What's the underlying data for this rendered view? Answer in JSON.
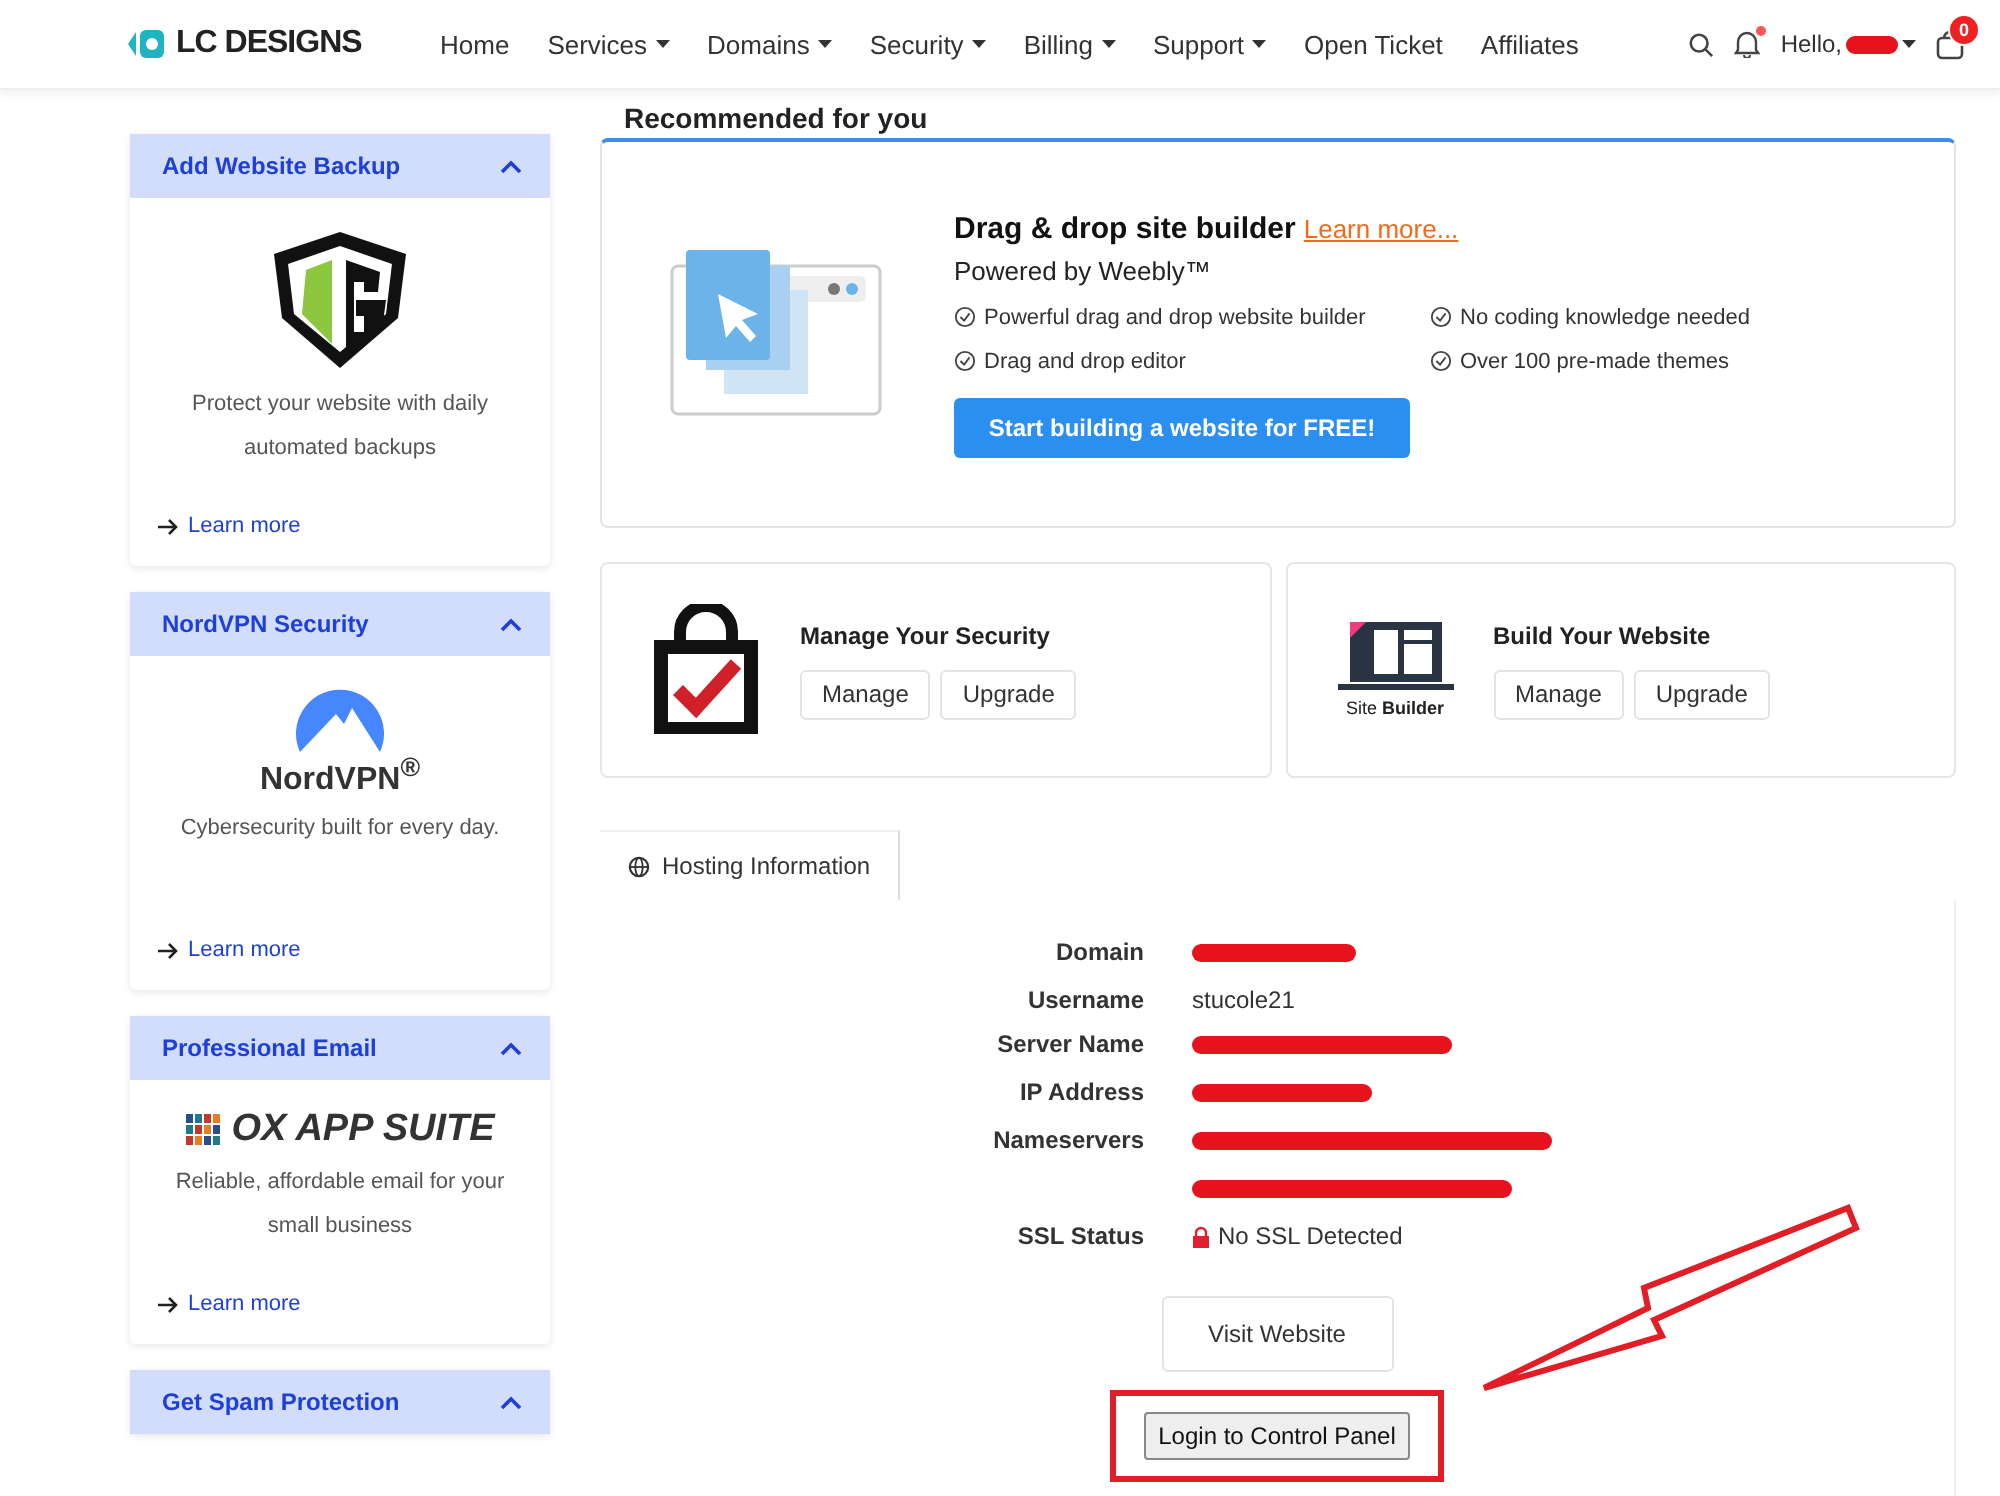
{
  "header": {
    "logo": "LC DESIGNS",
    "nav": [
      {
        "label": "Home",
        "dropdown": false
      },
      {
        "label": "Services",
        "dropdown": true
      },
      {
        "label": "Domains",
        "dropdown": true
      },
      {
        "label": "Security",
        "dropdown": true
      },
      {
        "label": "Billing",
        "dropdown": true
      },
      {
        "label": "Support",
        "dropdown": true
      },
      {
        "label": "Open Ticket",
        "dropdown": false
      },
      {
        "label": "Affiliates",
        "dropdown": false
      }
    ],
    "greeting": "Hello,",
    "notification_dot": true,
    "cart_count": "0"
  },
  "sidebar": {
    "cards": [
      {
        "title": "Add Website Backup",
        "expanded": true,
        "logo": {
          "kind": "shield"
        },
        "description": "Protect your website with daily automated backups",
        "link": "Learn more"
      },
      {
        "title": "NordVPN Security",
        "expanded": true,
        "logo": {
          "kind": "nordvpn",
          "text": "NordVPN$^{®}$"
        },
        "description": "Cybersecurity built for every day.",
        "link": "Learn more"
      },
      {
        "title": "Professional Email",
        "expanded": true,
        "logo": {
          "kind": "ox",
          "text": "OX APP SUITE"
        },
        "description": "Reliable, affordable email for your small business",
        "link": "Learn more"
      },
      {
        "title": "Get Spam Protection",
        "expanded": true
      }
    ]
  },
  "recommended": {
    "heading": "Recommended for you",
    "title": "Drag & drop site builder",
    "link": "Learn more...",
    "subtitle": "Powered by Weebly™",
    "features": [
      "Powerful drag and drop website builder",
      "No coding knowledge needed",
      "Drag and drop editor",
      "Over 100 pre-made themes"
    ],
    "button": "Start building a website for FREE!"
  },
  "products": [
    {
      "title": "Manage Your Security",
      "icon": {
        "kind": "lock"
      },
      "buttons": [
        "Manage",
        "Upgrade"
      ]
    },
    {
      "title": "Build Your Website",
      "icon": {
        "kind": "site_builder",
        "caption": "Site **Builder**"
      },
      "buttons": [
        "Manage",
        "Upgrade"
      ]
    }
  ],
  "hosting": {
    "tab": {
      "label": "Hosting Information",
      "selected": true
    },
    "rows": [
      {
        "label": "Domain",
        "kind": "redacted"
      },
      {
        "label": "Username",
        "kind": "text",
        "value": "stucole21"
      },
      {
        "label": "Server Name",
        "kind": "redacted"
      },
      {
        "label": "IP Address",
        "kind": "redacted"
      },
      {
        "label": "Nameservers",
        "kind": "redacted"
      },
      {
        "kind": "redacted"
      },
      {
        "label": "SSL Status",
        "kind": "ssl",
        "value": "No SSL Detected"
      }
    ],
    "visit_button": "Visit Website",
    "login_button": "Login to Control Panel",
    "login_highlighted": true,
    "arrow_annotation": true
  }
}
